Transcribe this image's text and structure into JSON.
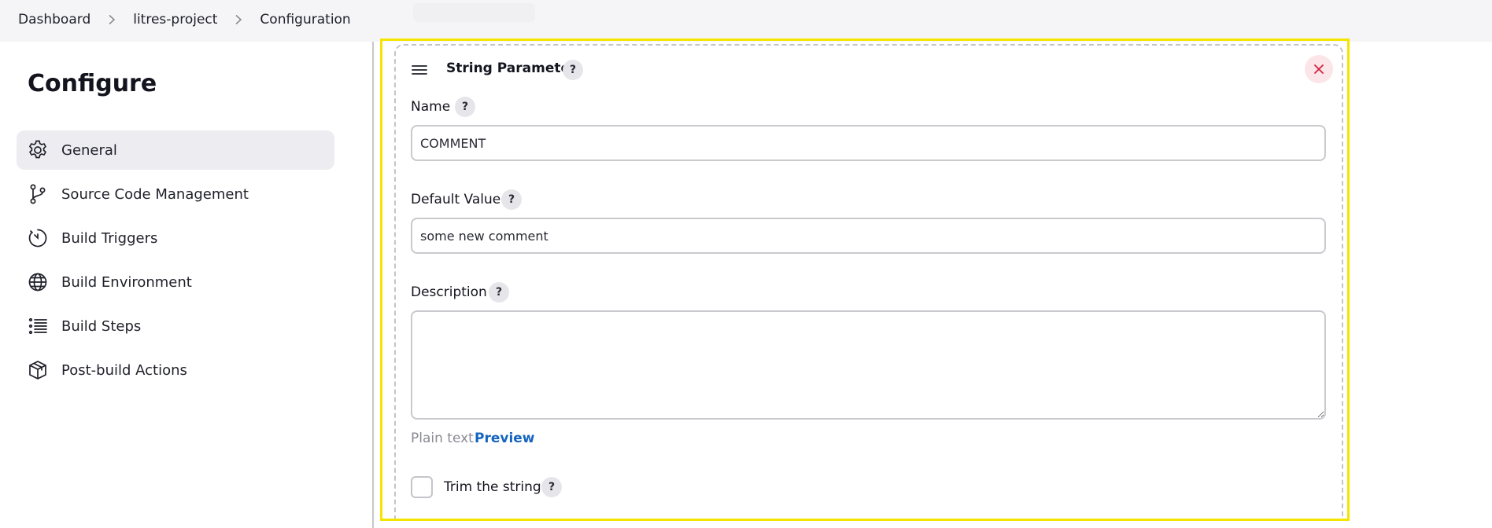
{
  "breadcrumb": {
    "items": [
      "Dashboard",
      "litres-project",
      "Configuration"
    ]
  },
  "sidebar": {
    "title": "Configure",
    "items": [
      {
        "label": "General",
        "icon": "gear-icon",
        "active": true
      },
      {
        "label": "Source Code Management",
        "icon": "git-branch-icon",
        "active": false
      },
      {
        "label": "Build Triggers",
        "icon": "timer-icon",
        "active": false
      },
      {
        "label": "Build Environment",
        "icon": "globe-icon",
        "active": false
      },
      {
        "label": "Build Steps",
        "icon": "list-icon",
        "active": false
      },
      {
        "label": "Post-build Actions",
        "icon": "package-icon",
        "active": false
      }
    ]
  },
  "parameter": {
    "title": "String Parameter",
    "help": "?",
    "name_label": "Name",
    "name_value": "COMMENT",
    "default_label": "Default Value",
    "default_value": "some new comment",
    "description_label": "Description",
    "description_value": "",
    "plain_text": "Plain text",
    "preview": "Preview",
    "trim_label": "Trim the string",
    "trim_checked": false
  },
  "colors": {
    "highlight": "#f5e400",
    "link": "#1565c0",
    "close_bg": "#fbe5e8",
    "close_icon": "#d0243f"
  }
}
